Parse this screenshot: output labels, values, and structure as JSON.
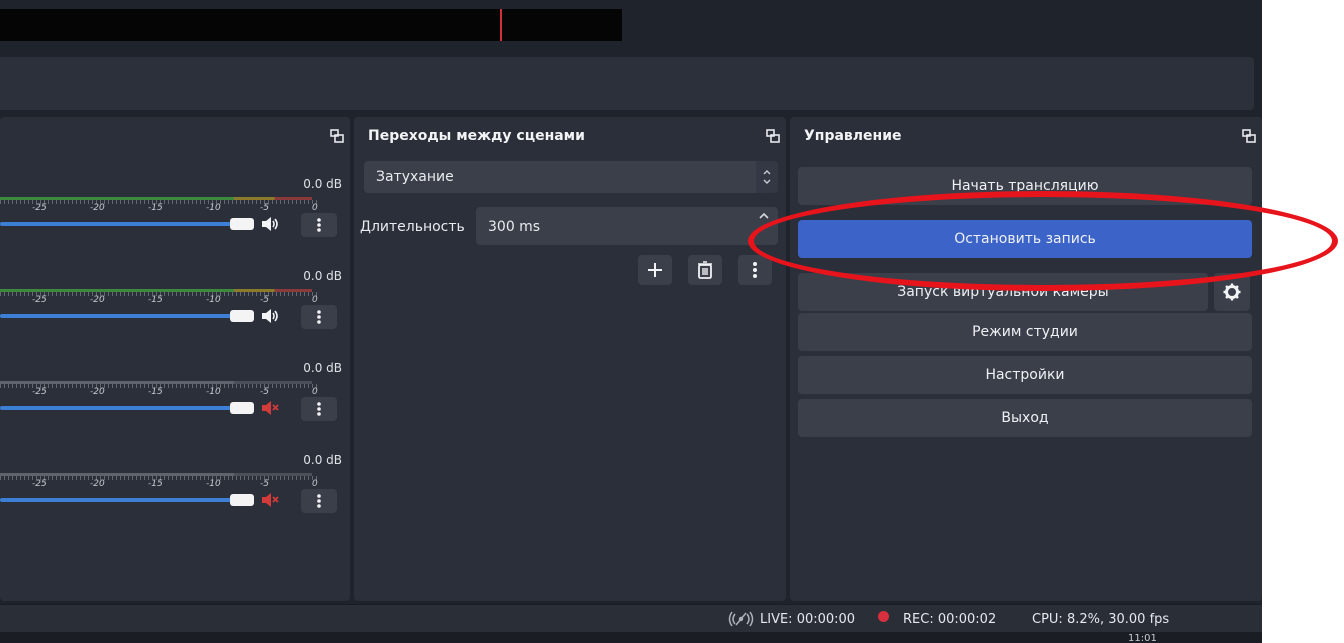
{
  "preview": {},
  "mixer": {
    "tracks": [
      {
        "db": "0.0 dB",
        "muted": false
      },
      {
        "db": "0.0 dB",
        "muted": false
      },
      {
        "db": "0.0 dB",
        "muted": true
      },
      {
        "db": "0.0 dB",
        "muted": true
      }
    ],
    "tick_labels": [
      "-25",
      "-20",
      "-15",
      "-10",
      "-5",
      "0"
    ]
  },
  "transitions": {
    "title": "Переходы между сценами",
    "selected_transition": "Затухание",
    "duration_label": "Длительность",
    "duration_value": "300 ms"
  },
  "controls": {
    "title": "Управление",
    "buttons": {
      "start_stream": "Начать трансляцию",
      "stop_recording": "Остановить запись",
      "virtual_camera": "Запуск виртуальной камеры",
      "studio_mode": "Режим студии",
      "settings": "Настройки",
      "exit": "Выход"
    }
  },
  "status": {
    "live": "LIVE: 00:00:00",
    "rec": "REC: 00:00:02",
    "cpu": "CPU: 8.2%, 30.00 fps",
    "clock": "11:01"
  },
  "colors": {
    "accent": "#3c64c8",
    "panel": "#2b2f39",
    "button": "#3b3f4a",
    "annotation": "#e8141c",
    "rec_dot": "#d6303e"
  },
  "icons": [
    "undock-icon",
    "volume-icon",
    "muted-volume-icon",
    "kebab-menu-icon",
    "plus-icon",
    "trash-icon",
    "gear-icon",
    "live-signal-icon",
    "record-dot-icon"
  ]
}
